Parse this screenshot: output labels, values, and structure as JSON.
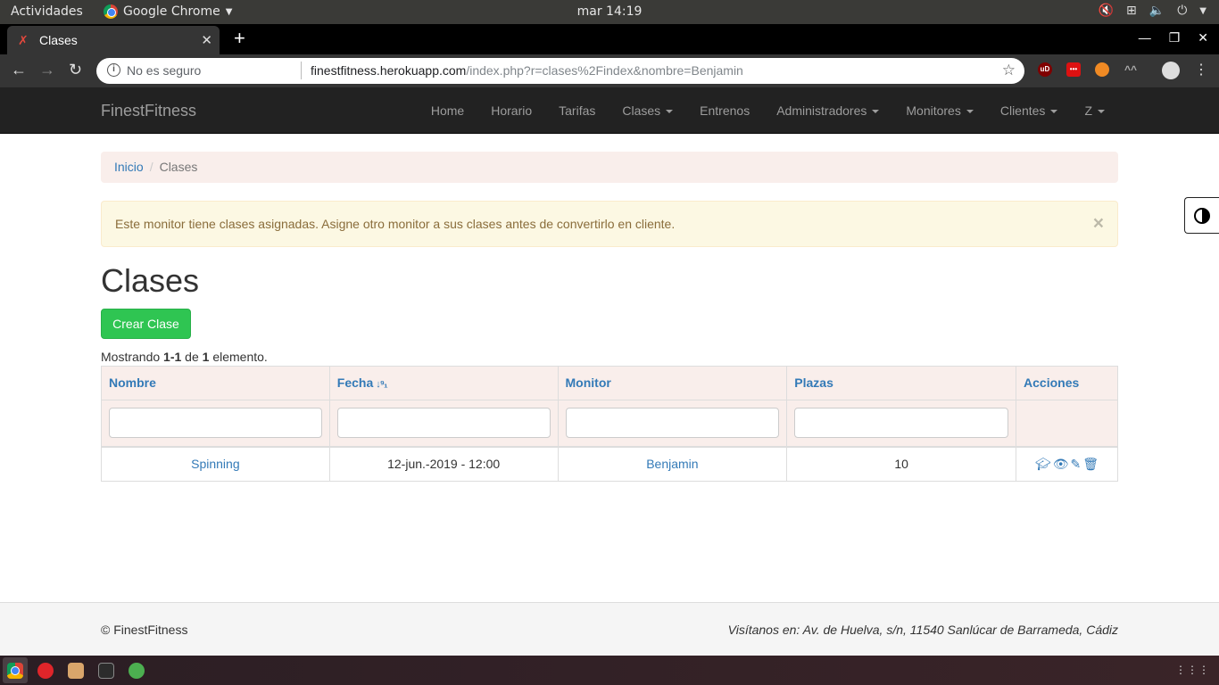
{
  "gnome": {
    "activities": "Actividades",
    "app_name": "Google Chrome",
    "clock": "mar 14:19"
  },
  "browser": {
    "tab_title": "Clases",
    "insecure_label": "No es seguro",
    "url_host": "finestfitness.herokuapp.com",
    "url_path": "/index.php?r=clases%2Findex&nombre=Benjamin"
  },
  "navbar": {
    "brand": "FinestFitness",
    "items": [
      {
        "label": "Home",
        "dropdown": false
      },
      {
        "label": "Horario",
        "dropdown": false
      },
      {
        "label": "Tarifas",
        "dropdown": false
      },
      {
        "label": "Clases",
        "dropdown": true
      },
      {
        "label": "Entrenos",
        "dropdown": false
      },
      {
        "label": "Administradores",
        "dropdown": true
      },
      {
        "label": "Monitores",
        "dropdown": true
      },
      {
        "label": "Clientes",
        "dropdown": true
      },
      {
        "label": "Z",
        "dropdown": true
      }
    ]
  },
  "breadcrumb": {
    "home": "Inicio",
    "current": "Clases"
  },
  "alert": {
    "message": "Este monitor tiene clases asignadas. Asigne otro monitor a sus clases antes de convertirlo en cliente.",
    "close": "×"
  },
  "page": {
    "title": "Clases",
    "create_button": "Crear Clase",
    "summary_prefix": "Mostrando ",
    "summary_range": "1-1",
    "summary_mid": " de ",
    "summary_total": "1",
    "summary_suffix": " elemento."
  },
  "table": {
    "columns": [
      "Nombre",
      "Fecha",
      "Monitor",
      "Plazas",
      "Acciones"
    ],
    "rows": [
      {
        "nombre": "Spinning",
        "fecha": "12-jun.-2019 - 12:00",
        "monitor": "Benjamin",
        "plazas": "10"
      }
    ]
  },
  "footer": {
    "copyright": "© FinestFitness",
    "address": "Visítanos en: Av. de Huelva, s/n, 11540 Sanlúcar de Barrameda, Cádiz"
  },
  "colors": {
    "link": "#337ab7",
    "success": "#2fc552",
    "navbar_bg": "#222222",
    "table_header_bg": "#f9eeeb",
    "alert_bg": "#fcf8e3"
  }
}
